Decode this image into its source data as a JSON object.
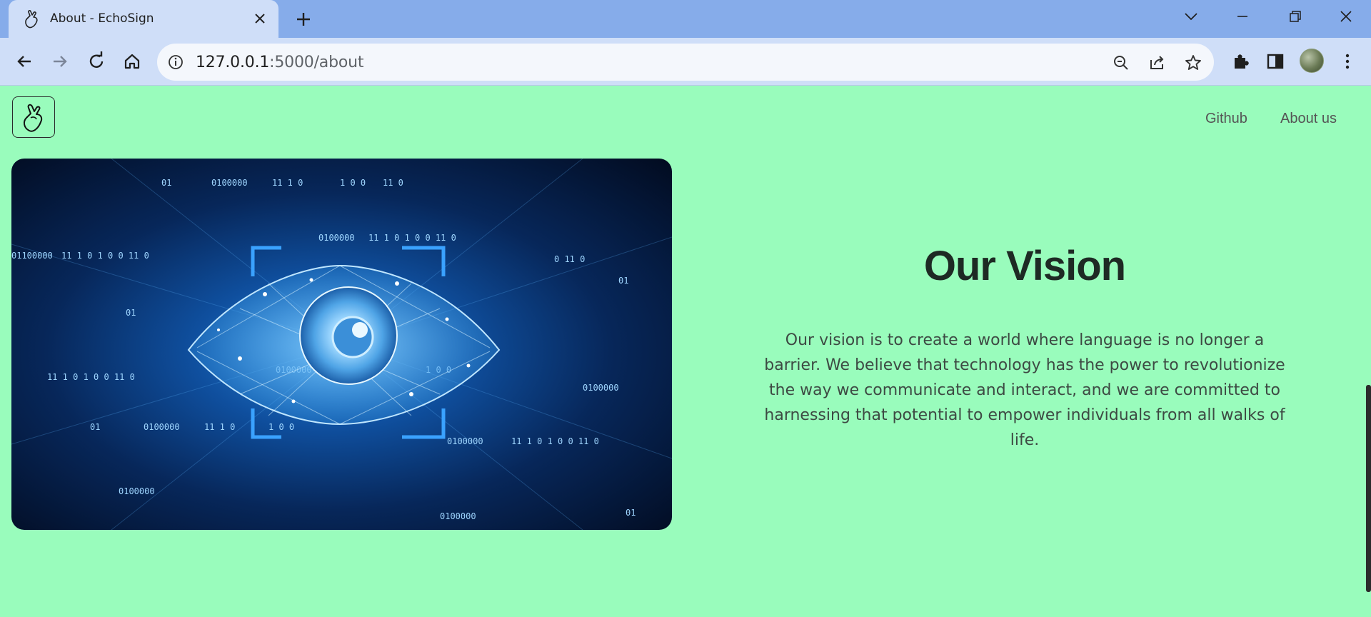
{
  "browser": {
    "tab_title": "About - EchoSign",
    "url_host": "127.0.0.1",
    "url_path": ":5000/about"
  },
  "nav": {
    "links": [
      "Github",
      "About us"
    ]
  },
  "main": {
    "title": "Our Vision",
    "body": "Our vision is to create a world where language is no longer a barrier. We believe that technology has the power to revolutionize the way we communicate and interact, and we are committed to harnessing that potential to empower individuals from all walks of life."
  },
  "image": {
    "code_texts": [
      "01",
      "0100000",
      "11 1 0",
      "1 0 0",
      "11 0",
      "01100000",
      "0 11 0",
      "11 1 0 1 0 0 11 0"
    ]
  },
  "colors": {
    "page_bg": "#99fcbc",
    "tabbar_bg": "#86acea",
    "toolbar_bg": "#cfdef8"
  }
}
